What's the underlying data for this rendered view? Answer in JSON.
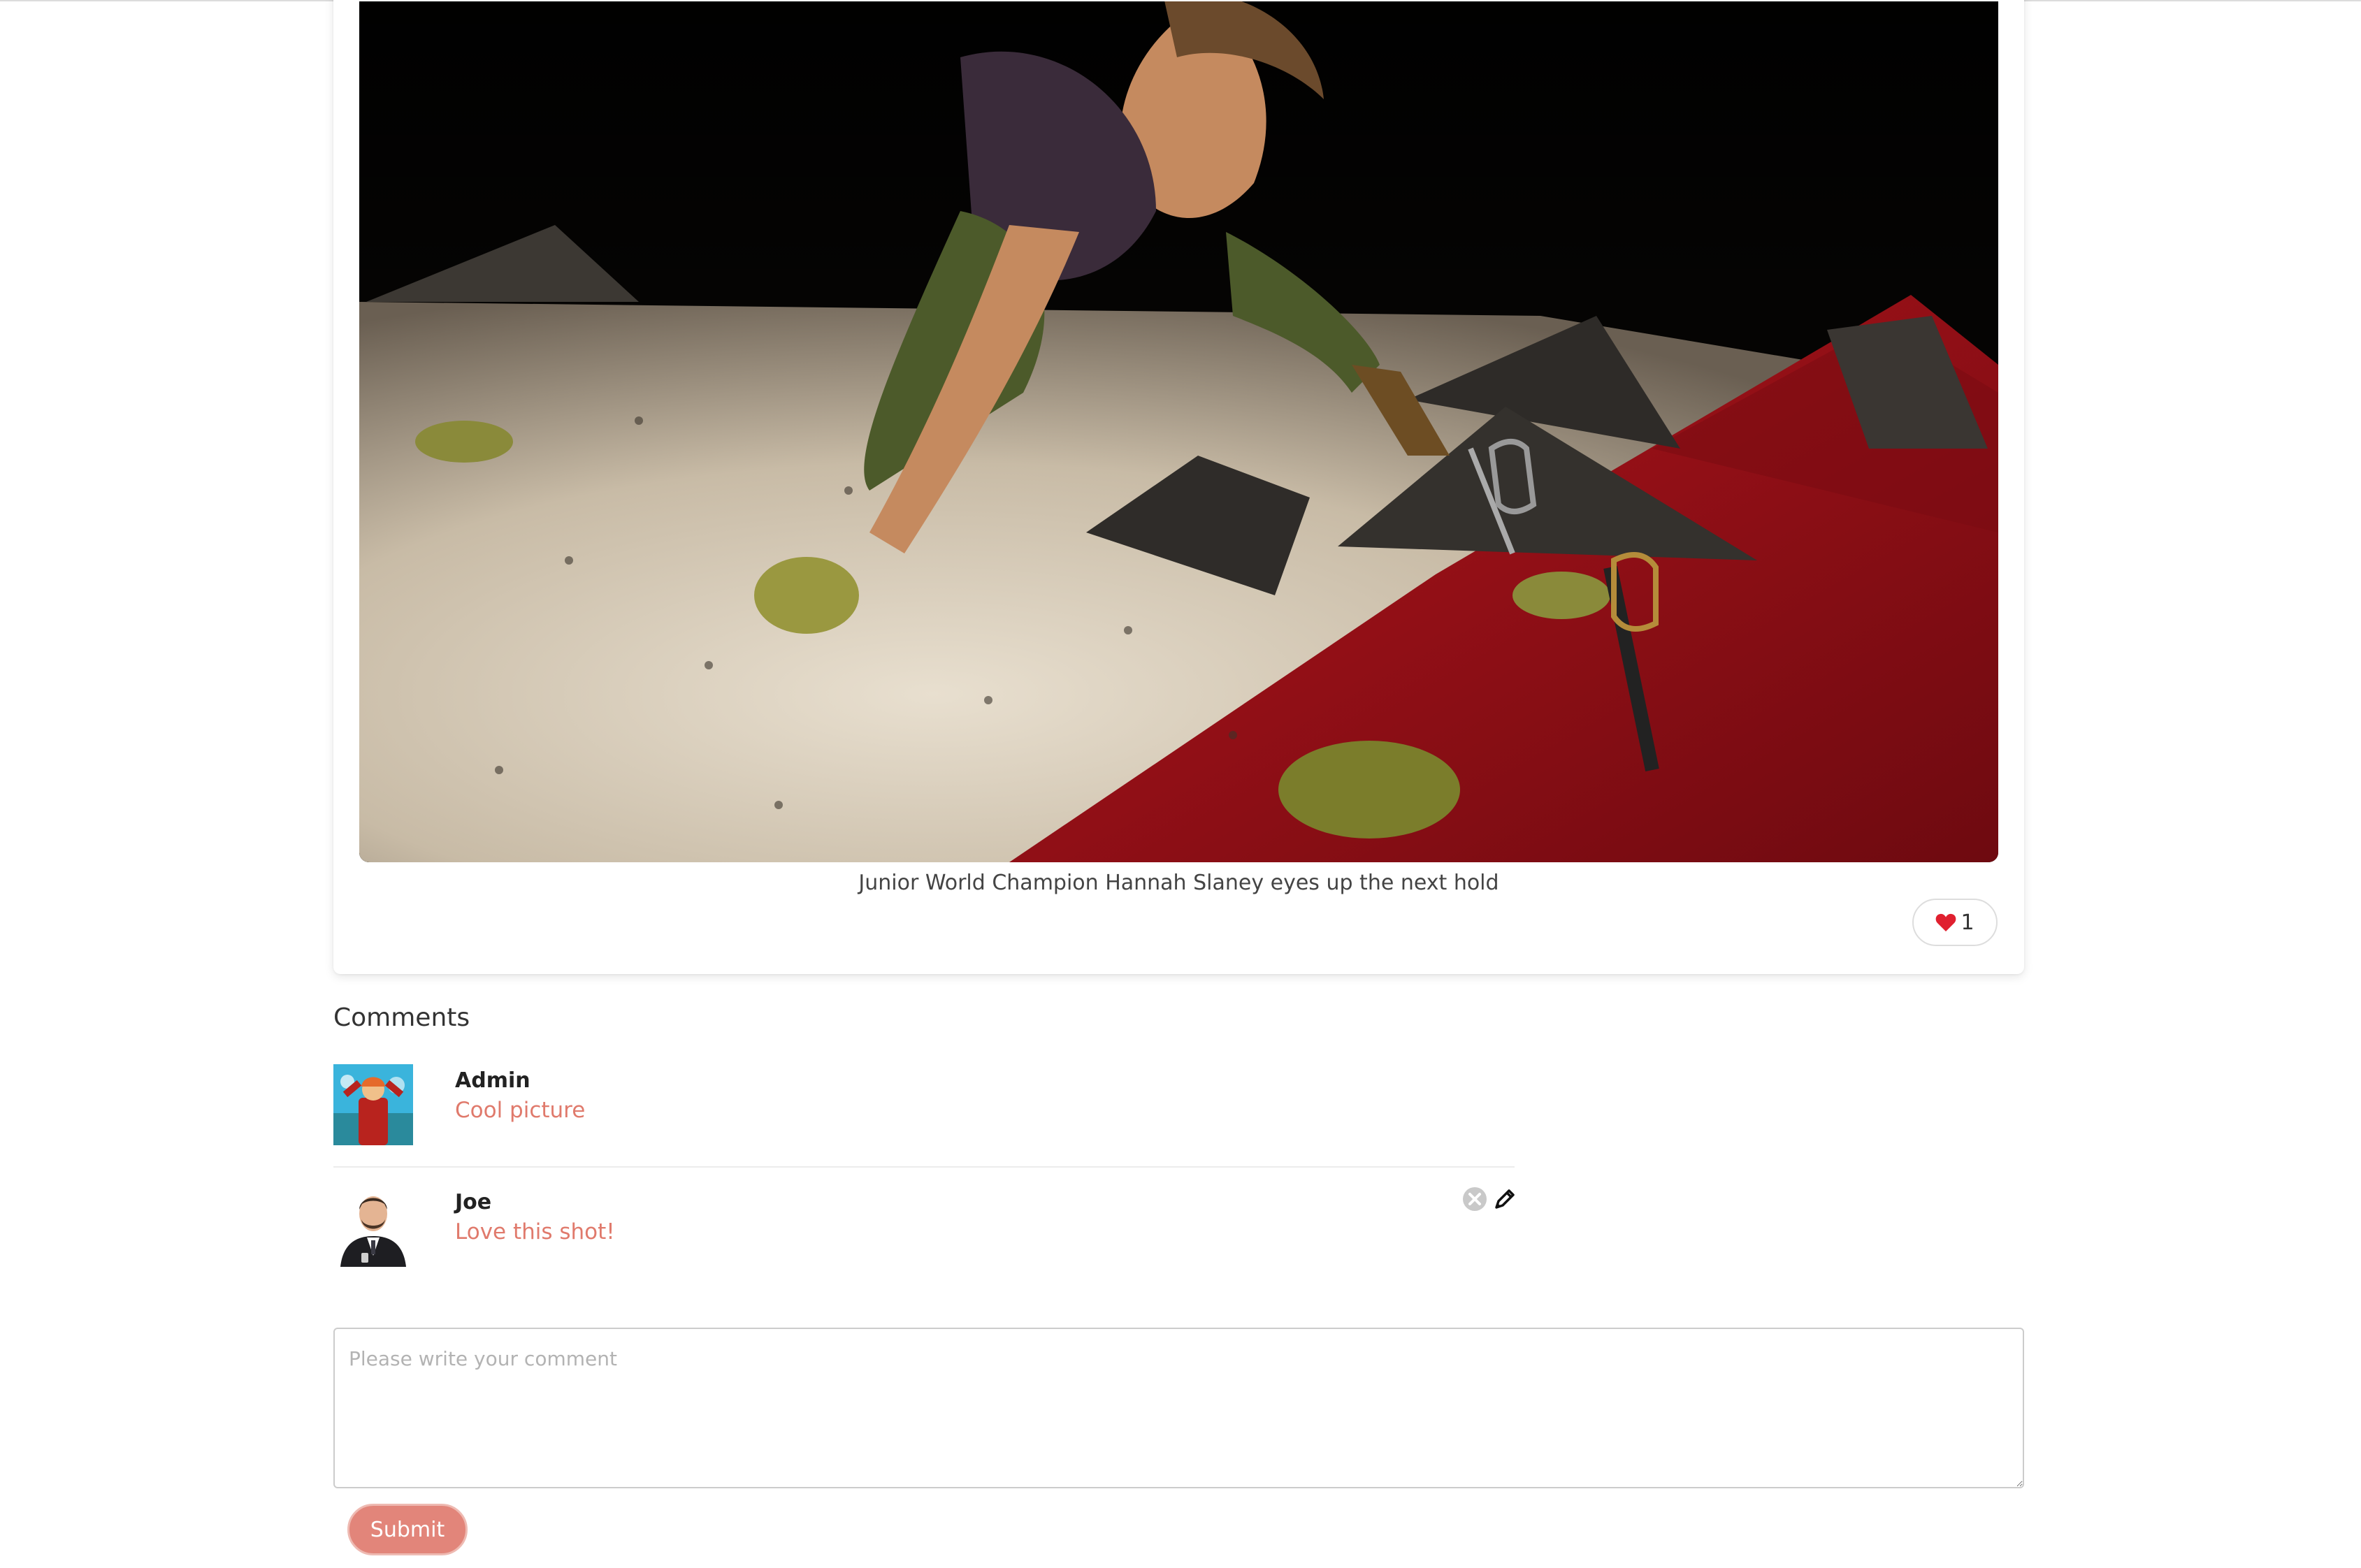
{
  "photo": {
    "caption": "Junior World Champion Hannah Slaney eyes up the next hold",
    "alt": "Climber reaching for a hold on a climbing wall"
  },
  "likes": {
    "icon": "heart-icon",
    "count": "1",
    "heart_color": "#e0202f"
  },
  "comments": {
    "title": "Comments",
    "items": [
      {
        "author": "Admin",
        "text": "Cool picture",
        "avatar_icon": "cartoon-avatar"
      },
      {
        "author": "Joe",
        "text": "Love this shot!",
        "avatar_icon": "man-in-suit-avatar"
      }
    ],
    "text_color": "#e07a6c"
  },
  "form": {
    "placeholder": "Please write your comment",
    "submit_label": "Submit",
    "submit_color": "#e2857a"
  }
}
